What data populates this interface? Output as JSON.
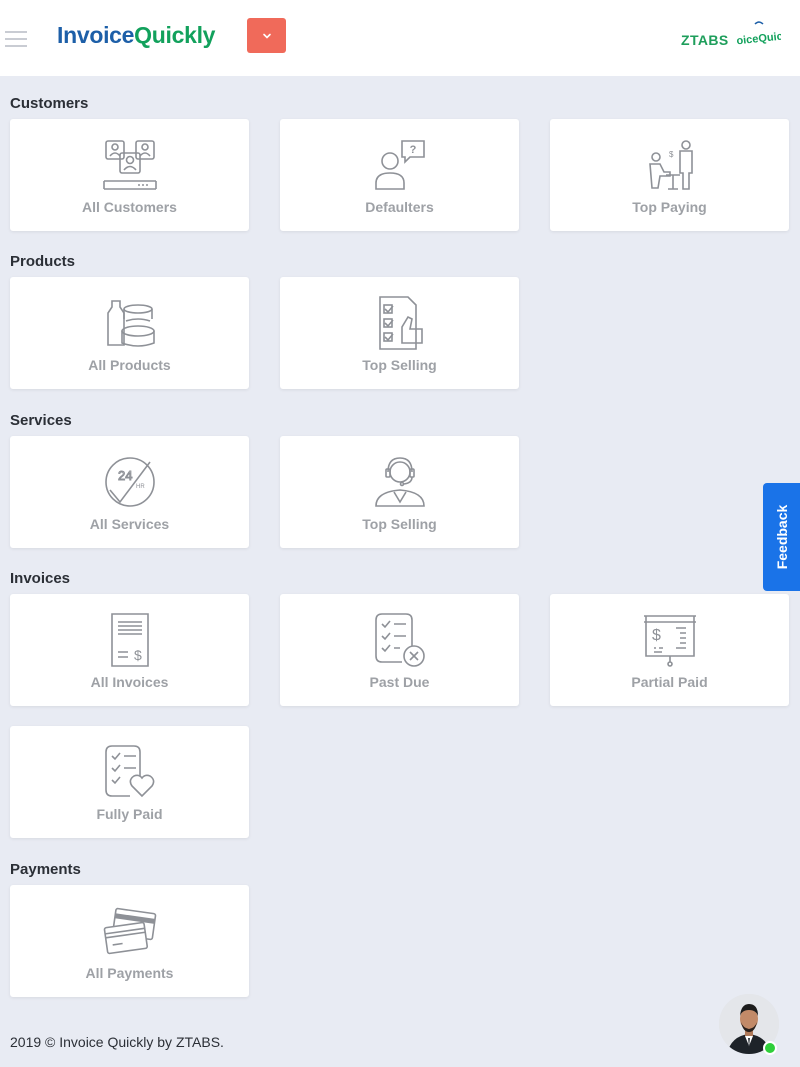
{
  "header": {
    "logo_part1": "Invoice",
    "logo_part2": "Quickly",
    "brand_text": "ZTABS",
    "brand_logo_text": "InvoiceQuickly"
  },
  "sections": {
    "customers": {
      "title": "Customers",
      "cards": [
        {
          "label": "All Customers",
          "icon": "customers-icon"
        },
        {
          "label": "Defaulters",
          "icon": "defaulter-icon"
        },
        {
          "label": "Top Paying",
          "icon": "top-paying-icon"
        }
      ]
    },
    "products": {
      "title": "Products",
      "cards": [
        {
          "label": "All Products",
          "icon": "products-icon"
        },
        {
          "label": "Top Selling",
          "icon": "top-selling-checklist-icon"
        }
      ]
    },
    "services": {
      "title": "Services",
      "cards": [
        {
          "label": "All Services",
          "icon": "24hr-service-icon"
        },
        {
          "label": "Top Selling",
          "icon": "support-agent-icon"
        }
      ]
    },
    "invoices": {
      "title": "Invoices",
      "cards": [
        {
          "label": "All Invoices",
          "icon": "invoice-receipt-icon"
        },
        {
          "label": "Past Due",
          "icon": "past-due-icon"
        },
        {
          "label": "Partial Paid",
          "icon": "partial-paid-icon"
        },
        {
          "label": "Fully Paid",
          "icon": "fully-paid-icon"
        }
      ]
    },
    "payments": {
      "title": "Payments",
      "cards": [
        {
          "label": "All Payments",
          "icon": "credit-cards-icon"
        }
      ]
    }
  },
  "feedback_label": "Feedback",
  "footer_text": "2019 © Invoice Quickly by ZTABS.",
  "colors": {
    "accent_red": "#f06a5a",
    "logo_blue": "#1d5fa8",
    "logo_green": "#12a15c",
    "feedback_blue": "#1a73e8",
    "online_green": "#2fcf3a"
  }
}
